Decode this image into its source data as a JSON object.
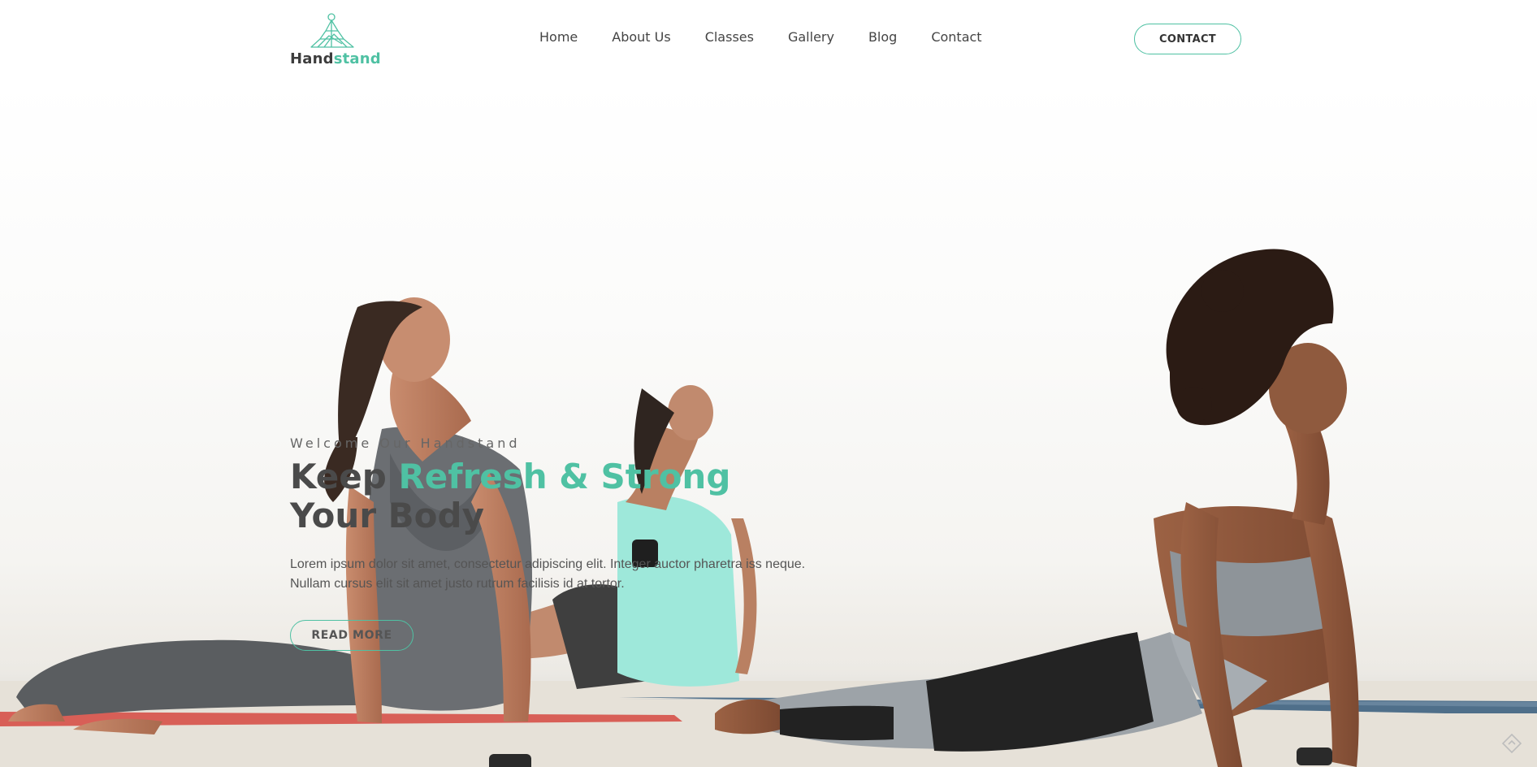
{
  "brand": {
    "name_part1": "Hand",
    "name_part2": "stand",
    "accent_color": "#4fc1a3",
    "logo_icon": "yoga-pose-icon"
  },
  "nav": {
    "items": [
      {
        "label": "Home"
      },
      {
        "label": "About Us"
      },
      {
        "label": "Classes"
      },
      {
        "label": "Gallery"
      },
      {
        "label": "Blog"
      },
      {
        "label": "Contact"
      }
    ],
    "cta_label": "CONTACT"
  },
  "hero": {
    "eyebrow": "Welcome Our Handstand",
    "headline_before": "Keep ",
    "headline_accent": "Refresh & Strong",
    "headline_after": " Your Body",
    "description": "Lorem ipsum dolor sit amet, consectetur adipiscing elit. Integer auctor pharetra iss neque. Nullam cursus elit sit amet justo rutrum facilisis id at tortor.",
    "button_label": "READ MORE",
    "background_image": "three-women-yoga-cobra-pose-beach"
  },
  "floating": {
    "icon": "diamond-arrow-icon"
  }
}
